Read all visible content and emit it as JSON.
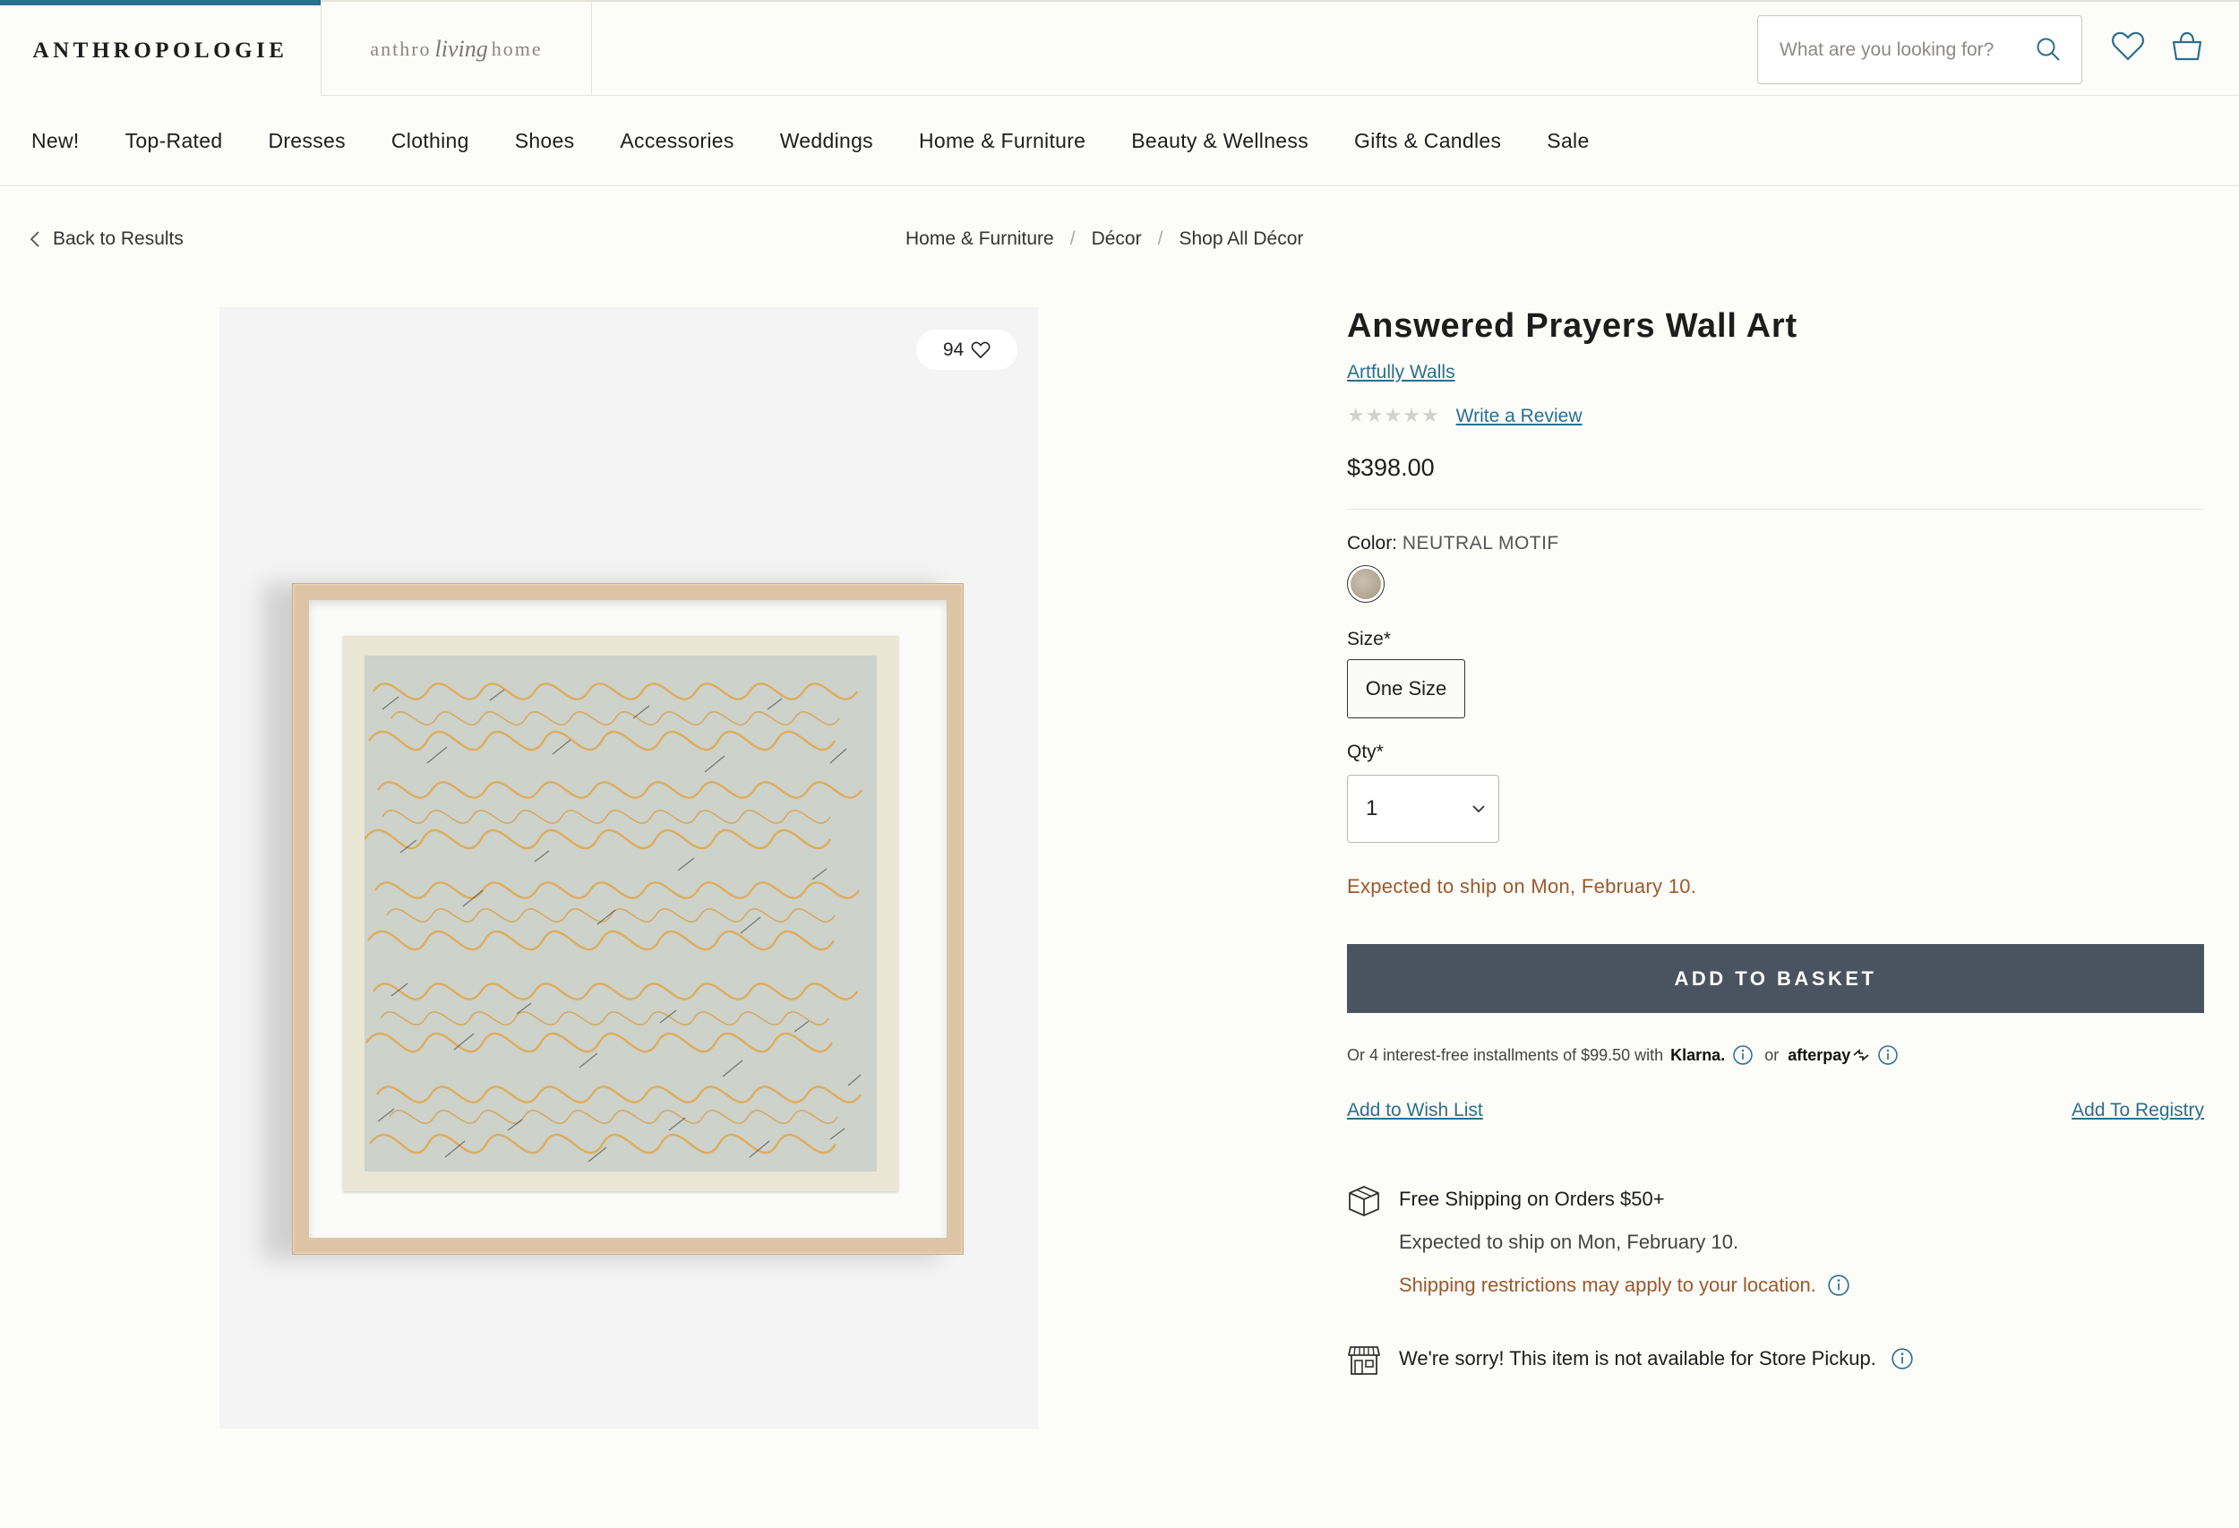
{
  "header": {
    "brand_main": "ANTHROPOLOGIE",
    "brand_living_prefix": "anthro",
    "brand_living_script": "living",
    "brand_living_suffix": "home",
    "search_placeholder": "What are you looking for?",
    "accent_color": "#2a6f8e"
  },
  "nav": {
    "items": [
      "New!",
      "Top-Rated",
      "Dresses",
      "Clothing",
      "Shoes",
      "Accessories",
      "Weddings",
      "Home & Furniture",
      "Beauty & Wellness",
      "Gifts & Candles",
      "Sale"
    ]
  },
  "back_label": "Back to Results",
  "breadcrumb": [
    "Home & Furniture",
    "Décor",
    "Shop All Décor"
  ],
  "image": {
    "favorites_count": "94"
  },
  "product": {
    "title": "Answered Prayers Wall Art",
    "brand": "Artfully Walls",
    "rating_stars": 0,
    "review_link": "Write a Review",
    "price": "$398.00",
    "color_label": "Color:",
    "color_value": "NEUTRAL MOTIF",
    "size_label": "Size*",
    "size_option": "One Size",
    "qty_label": "Qty*",
    "qty_value": "1",
    "ship_note": "Expected to ship on Mon, February 10.",
    "add_to_basket": "ADD TO BASKET",
    "installments_text": "Or 4 interest-free installments of $99.50 with",
    "klarna": "Klarna.",
    "or": "or",
    "afterpay": "afterpay",
    "wish_list": "Add to Wish List",
    "registry": "Add To Registry",
    "shipping_title": "Free Shipping on Orders $50+",
    "shipping_expected": "Expected to ship on Mon, February 10.",
    "shipping_restrictions": "Shipping restrictions may apply to your location.",
    "pickup_text": "We're sorry! This item is not available for Store Pickup."
  },
  "colors": {
    "button_bg": "#4a5460",
    "link": "#2a6f8e",
    "warning_text": "#9a5a2c"
  }
}
